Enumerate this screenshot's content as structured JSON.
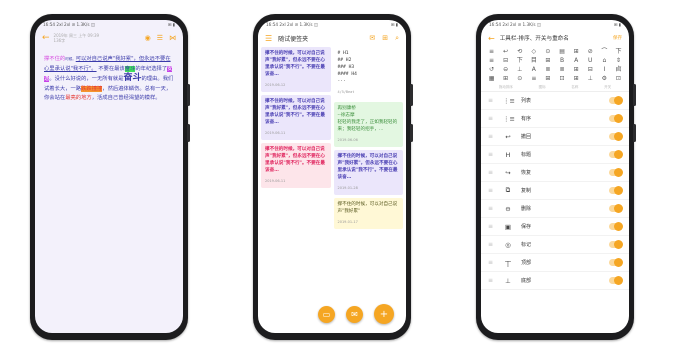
{
  "status_bar": {
    "left": "16:54 2xl 2xl ⊘ 1.3K/s ◫",
    "right": "⊞ ▮"
  },
  "screen1": {
    "meta_line1": "2019年 周三 上午 09:39",
    "meta_line2": "136字",
    "text_a": "撑不住的",
    "text_a_small": "时候。",
    "text_b": "可以对自己说声\"我好累\"，但永远不要在心里承认说\"我不行\"。",
    "text_c": "不要在最该",
    "text_c_hl": "奋斗",
    "text_d": "的年纪选择了",
    "text_d_hl": "安逸",
    "text_e": "。没什么好说的，一无所有就是",
    "text_f": "奋斗",
    "text_g": "的理由。我们试着长大，一路",
    "text_g_hl": "跌跌撞撞",
    "text_h": "，然后遍体鳞伤。总有一天，你会站在",
    "text_h_hl": "最亮的地方",
    "text_i": "，活成自己曾经渴望的模样。"
  },
  "screen2": {
    "title": "随试便签夹",
    "card1": "撑不住的时候，可以对自己说声\"我好累\"，但永远不要在心里承认说\"我不行\"。不要在最该奋…",
    "card1_date": "2019-06-12",
    "card2": "撑不住的时候，可以对自己说声\"我好累\"，但永远不要在心里承认说\"我不行\"。不要在最该奋…",
    "card2_date": "2019-06-11",
    "card3": "撑不住的时候，可以对自己说声\"我好累\"，但永远不要在心里承认说\"我不行\"。不要在最该奋…",
    "card3_date": "2019-06-11",
    "card4_lines": [
      "# H1",
      "## H2",
      "### H3",
      "#### H4",
      "···"
    ],
    "card4_date": "4/5/Beat",
    "card5_title": "再别康桥",
    "card5_author": "--徐志摩",
    "card5_body": "轻轻的我走了，正如我轻轻的来；我轻轻的招手，…",
    "card5_date": "2019-06-06",
    "card6": "撑不住的时候，可以对自己说声\"我好累\"，但永远不要在心里承认说\"我不行\"。不要在最该奋…",
    "card6_date": "2019-01-28",
    "card7": "撑不住的时候，可以对自己说声\"我好累\"",
    "card7_date": "2019-01-17"
  },
  "screen3": {
    "title": "工具栏-排序、开关与重命名",
    "save": "保存",
    "toolbar_glyphs": [
      "≡",
      "↩",
      "⟲",
      "◇",
      "⊙",
      "▤",
      "⊞",
      "⊘",
      "⌒",
      "下",
      "≡",
      "⊟",
      "下",
      "目",
      "⊞",
      "B",
      "A",
      "U",
      "⌂",
      "⇕",
      "↺",
      "⊖",
      "⊥",
      "A",
      "≣",
      "≣",
      "⊞",
      "⊟",
      "I",
      "卣",
      "▦",
      "⊞",
      "⊙",
      "≡",
      "⊞",
      "⊡",
      "⊞",
      "⊥",
      "⚙",
      "⊡"
    ],
    "list_head": [
      "拖动排序",
      "图标",
      "名称",
      "开关"
    ],
    "rows": [
      {
        "icon": "⋮≡",
        "label": "列表"
      },
      {
        "icon": "⋮≡",
        "label": "有序"
      },
      {
        "icon": "↩",
        "label": "撤回"
      },
      {
        "icon": "H",
        "label": "标题"
      },
      {
        "icon": "↪",
        "label": "恢复"
      },
      {
        "icon": "⧉",
        "label": "复制"
      },
      {
        "icon": "⊖",
        "label": "删除"
      },
      {
        "icon": "▣",
        "label": "保存"
      },
      {
        "icon": "◎",
        "label": "标记"
      },
      {
        "icon": "丅",
        "label": "顶部"
      },
      {
        "icon": "⊥",
        "label": "底部"
      }
    ]
  },
  "colors": {
    "accent": "#f5a623",
    "bg_note": "#f3f1fb"
  }
}
